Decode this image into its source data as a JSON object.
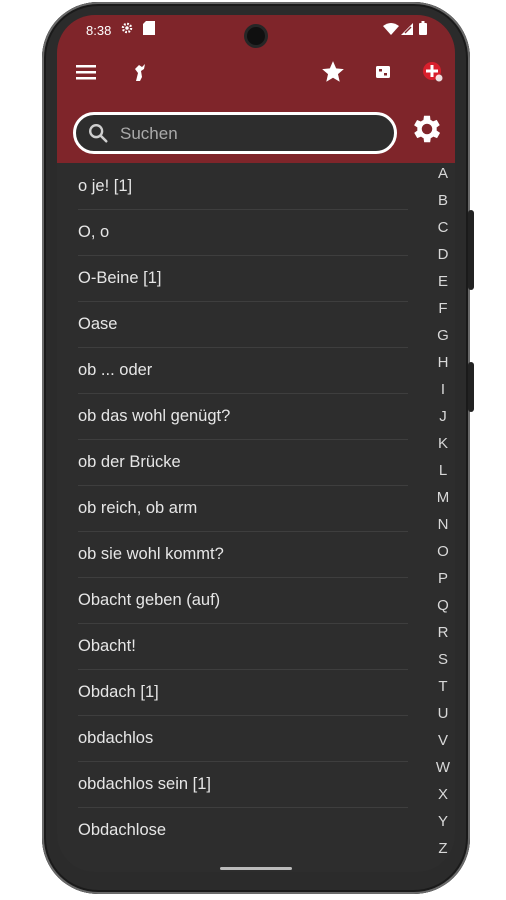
{
  "status_bar": {
    "time": "8:38"
  },
  "search": {
    "placeholder": "Suchen"
  },
  "list": {
    "items": [
      "o je! [1]",
      "O, o",
      "O-Beine [1]",
      "Oase",
      "ob ... oder",
      "ob das wohl genügt?",
      "ob der Brücke",
      "ob reich, ob arm",
      "ob sie wohl kommt?",
      "Obacht geben (auf)",
      "Obacht!",
      "Obdach [1]",
      "obdachlos",
      "obdachlos sein [1]",
      "Obdachlose"
    ]
  },
  "alphabet": [
    "A",
    "B",
    "C",
    "D",
    "E",
    "F",
    "G",
    "H",
    "I",
    "J",
    "K",
    "L",
    "M",
    "N",
    "O",
    "P",
    "Q",
    "R",
    "S",
    "T",
    "U",
    "V",
    "W",
    "X",
    "Y",
    "Z"
  ],
  "icons": {
    "menu": "hamburger-menu-icon",
    "logo": "horse-logo-icon",
    "favorites": "star-icon",
    "flashcards": "flashcard-icon",
    "add": "add-entry-icon",
    "settings": "gear-icon",
    "search": "search-icon"
  },
  "colors": {
    "appbar": "#7f252a",
    "background": "#2d2d2d",
    "text": "#e6e6e6",
    "accent": "#d91f2c"
  }
}
